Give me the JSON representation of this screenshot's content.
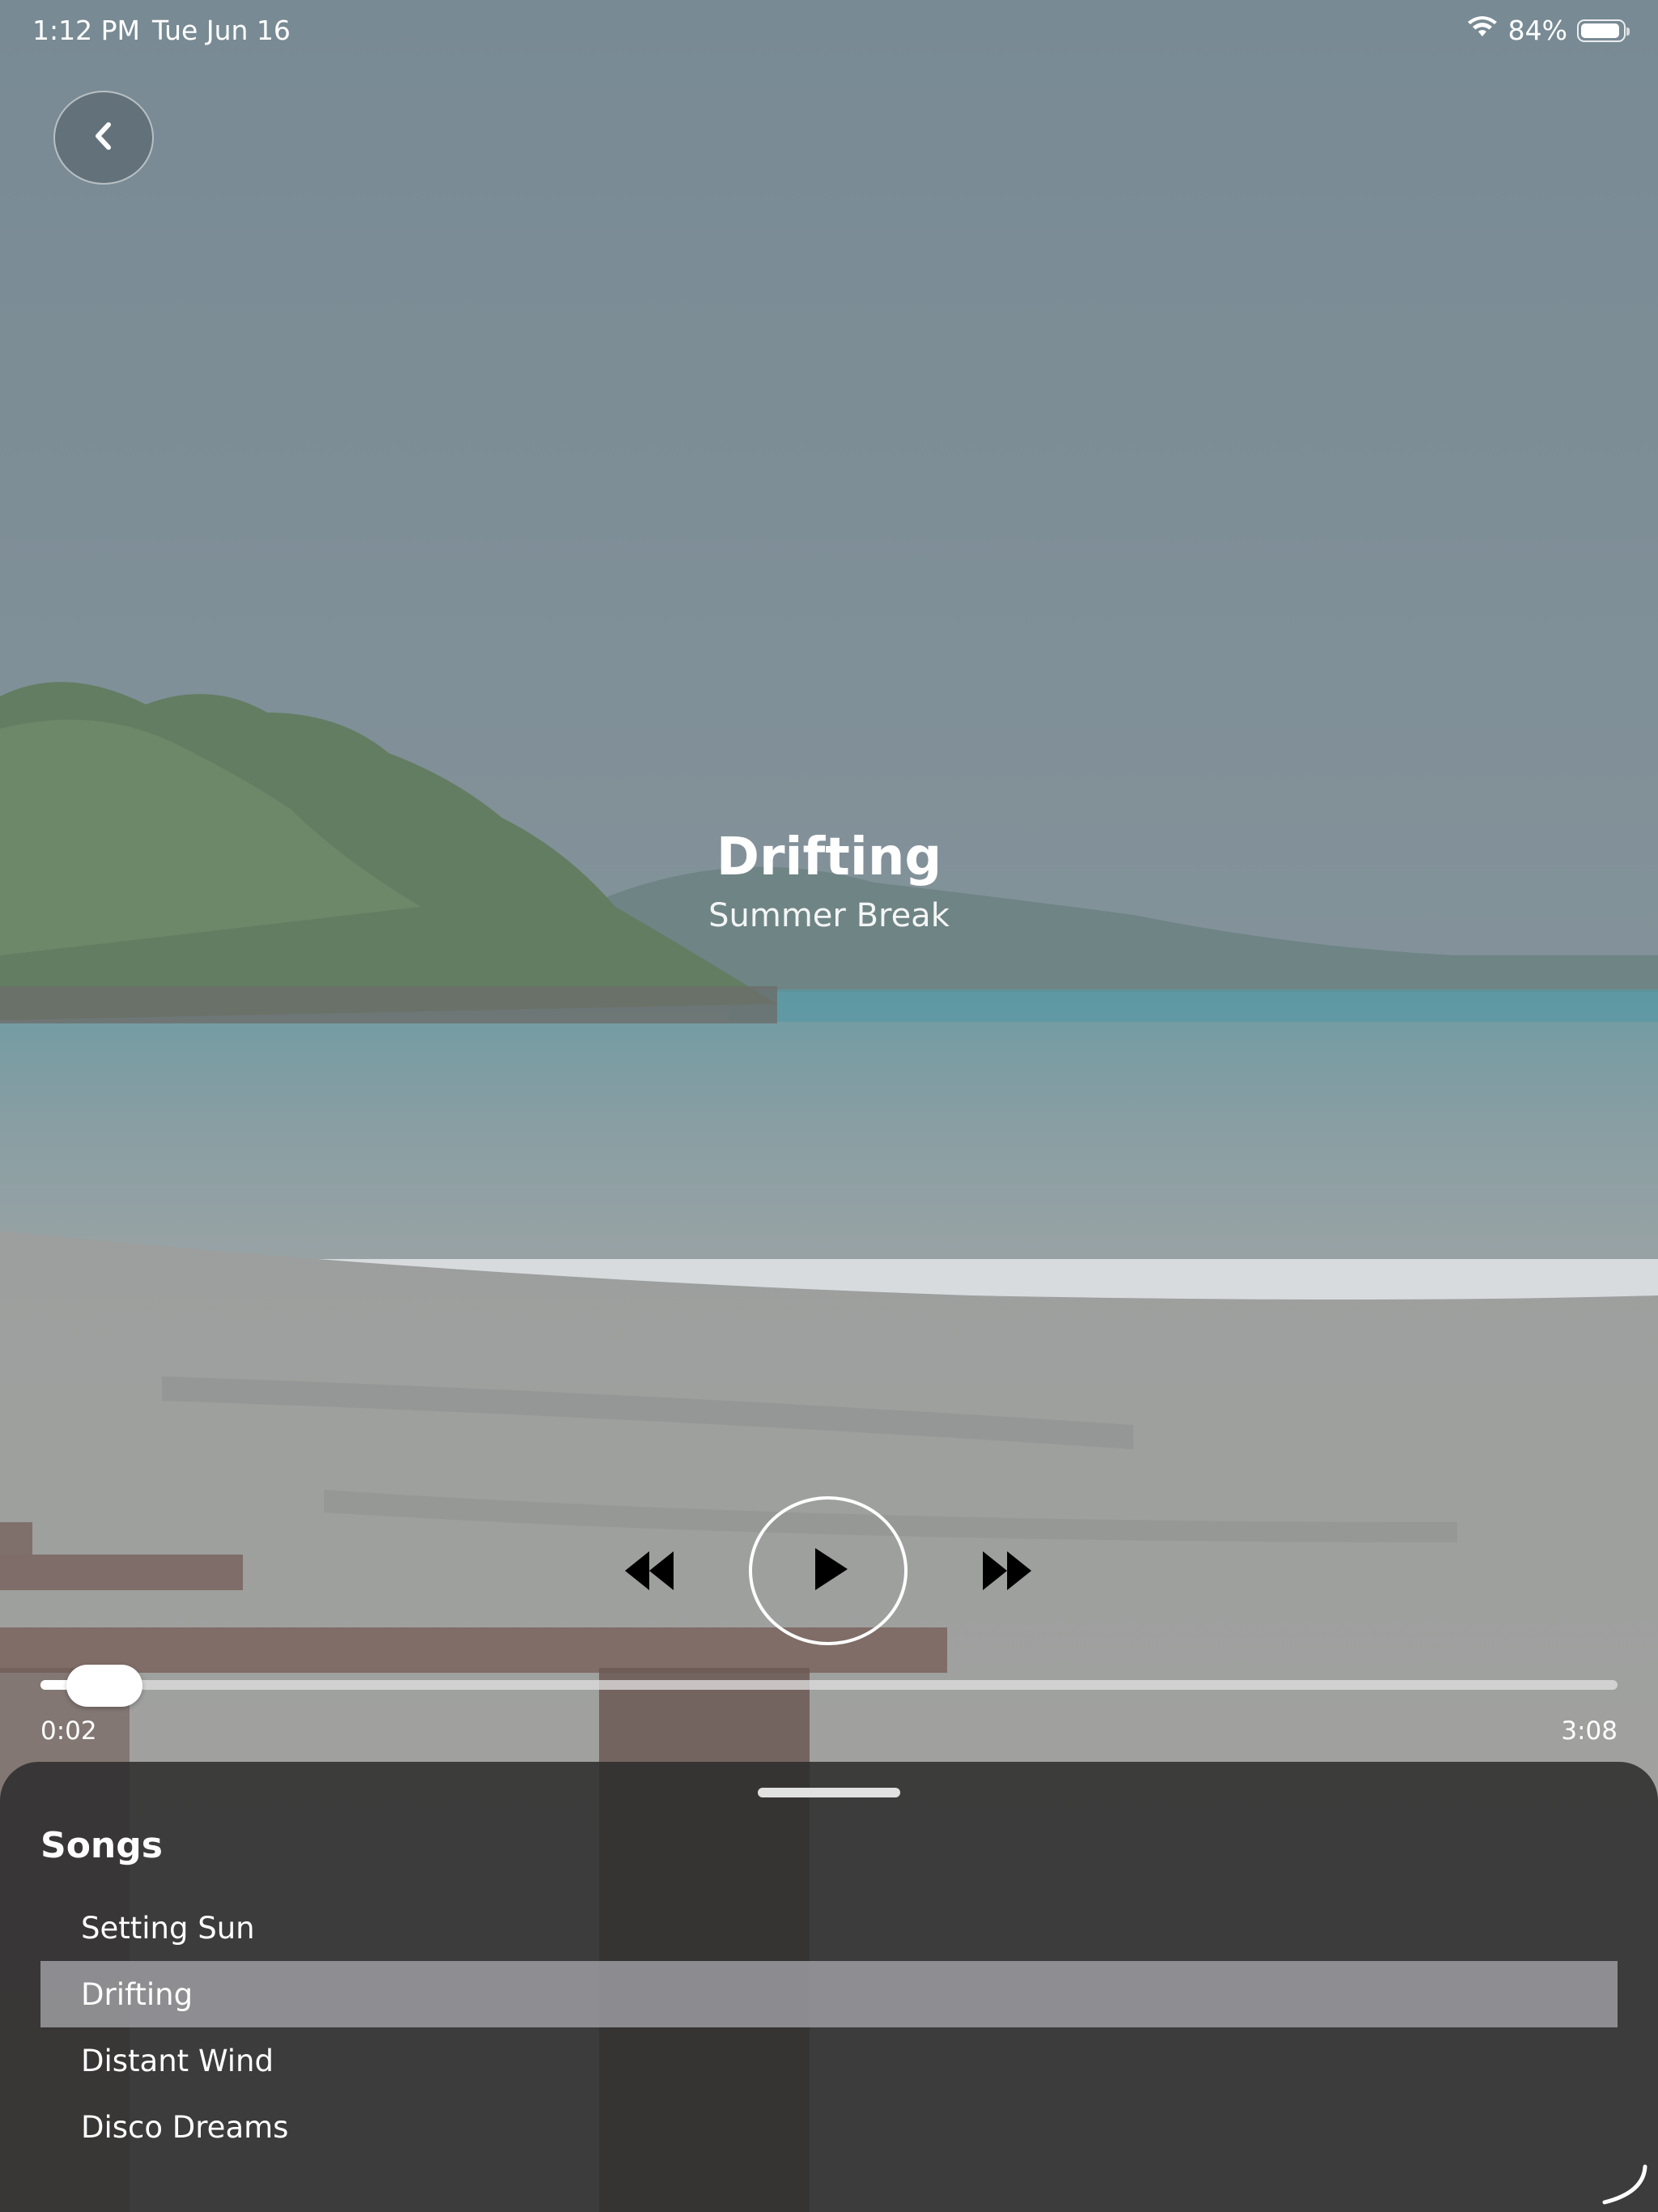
{
  "status_bar": {
    "time": "1:12 PM",
    "date": "Tue Jun 16",
    "battery_percent": "84%",
    "icons": [
      "wifi-icon",
      "battery-icon"
    ]
  },
  "nav": {
    "back_icon": "chevron-left-icon"
  },
  "track": {
    "title": "Drifting",
    "album": "Summer Break"
  },
  "controls": {
    "rewind_icon": "rewind-icon",
    "play_icon": "play-icon",
    "forward_icon": "fast-forward-icon"
  },
  "progress": {
    "elapsed": "0:02",
    "total": "3:08",
    "fraction": 0.011
  },
  "songs": {
    "heading": "Songs",
    "items": [
      {
        "label": "Setting Sun",
        "selected": false
      },
      {
        "label": "Drifting",
        "selected": true
      },
      {
        "label": "Distant Wind",
        "selected": false
      },
      {
        "label": "Disco Dreams",
        "selected": false
      }
    ]
  },
  "colors": {
    "sheet_background": "#2e2e2e",
    "selected_row": "#a0a0a5",
    "foreground": "#ffffff"
  }
}
